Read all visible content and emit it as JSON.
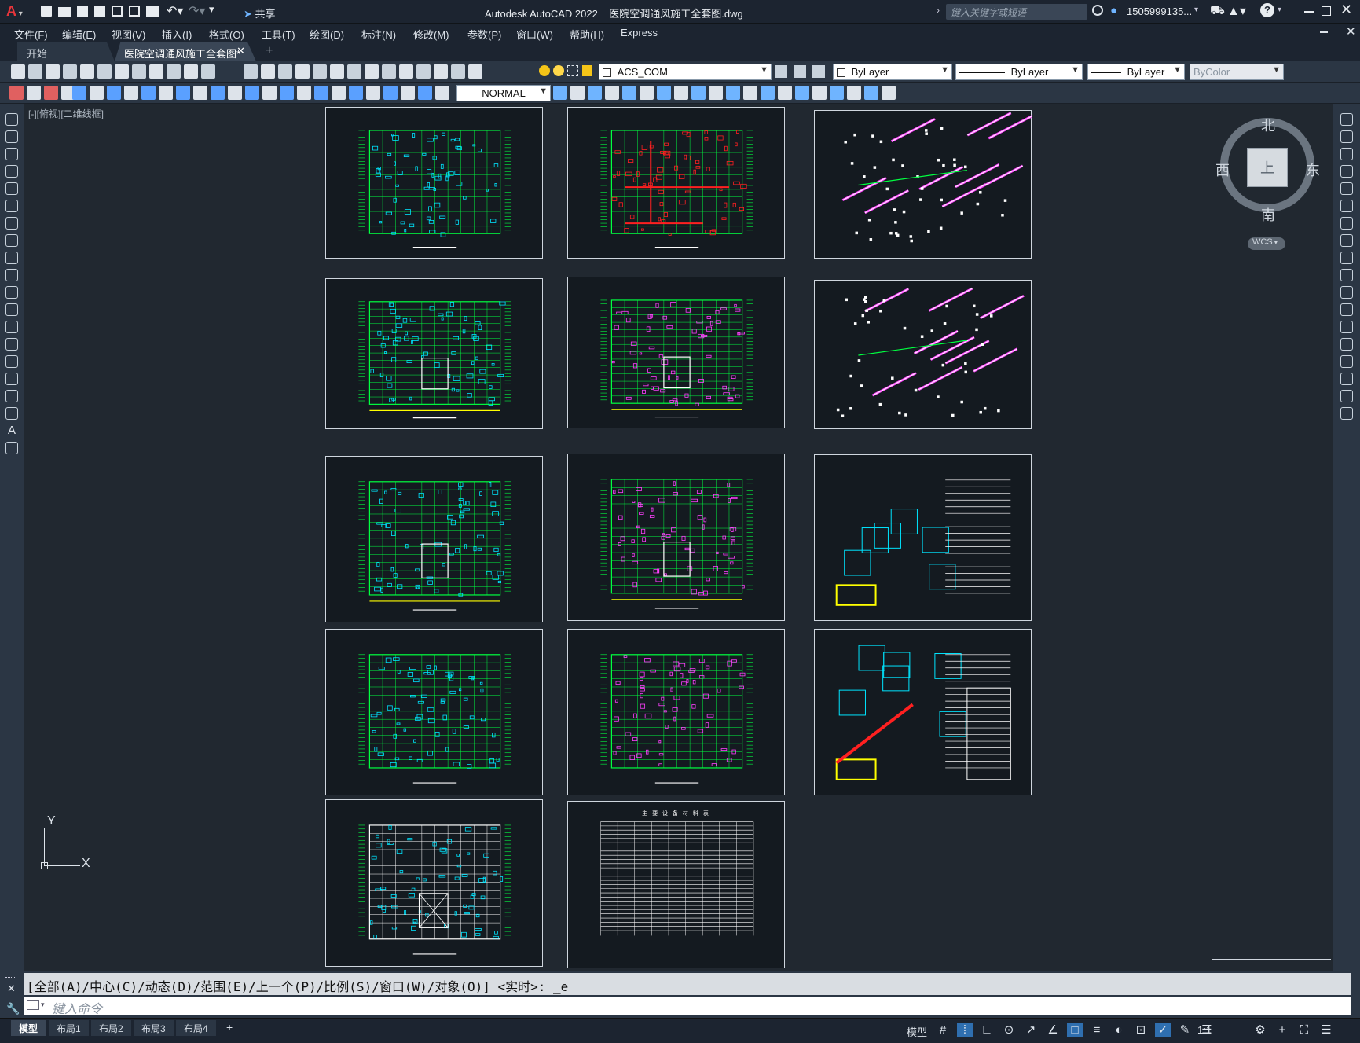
{
  "titlebar": {
    "app_title": "Autodesk AutoCAD 2022",
    "file_name": "医院空调通风施工全套图.dwg",
    "share_label": "共享",
    "search_placeholder": "键入关键字或短语",
    "user_name": "1505999135..."
  },
  "menu": [
    "文件(F)",
    "编辑(E)",
    "视图(V)",
    "插入(I)",
    "格式(O)",
    "工具(T)",
    "绘图(D)",
    "标注(N)",
    "修改(M)",
    "参数(P)",
    "窗口(W)",
    "帮助(H)",
    "Express"
  ],
  "tabs": {
    "start": "开始",
    "document": "医院空调通风施工全套图*"
  },
  "toolbar": {
    "layer_name": "ACS_COM",
    "color": "ByLayer",
    "linetype": "ByLayer",
    "lineweight": "ByLayer",
    "plotstyle": "ByColor",
    "text_style": "NORMAL"
  },
  "viewport": {
    "label": "[-][俯视][二维线框]"
  },
  "viewcube": {
    "north": "北",
    "south": "南",
    "east": "东",
    "west": "西",
    "top": "上",
    "wcs": "WCS"
  },
  "ucs": {
    "x": "X",
    "y": "Y"
  },
  "command": {
    "history": "[全部(A)/中心(C)/动态(D)/范围(E)/上一个(P)/比例(S)/窗口(W)/对象(O)] <实时>: _e",
    "placeholder": "键入命令"
  },
  "layouts": [
    "模型",
    "布局1",
    "布局2",
    "布局3",
    "布局4"
  ],
  "status": {
    "model": "模型",
    "scale": "1:1"
  },
  "sheets": {
    "equipment_table_title": "主 要 设 备 材 料 表"
  },
  "colors": {
    "canvas": "#212830",
    "drawing_green": "#00ff40",
    "drawing_cyan": "#00e5ff",
    "drawing_red": "#ff2020",
    "drawing_magenta": "#ff40ff",
    "drawing_yellow": "#ffff00"
  }
}
